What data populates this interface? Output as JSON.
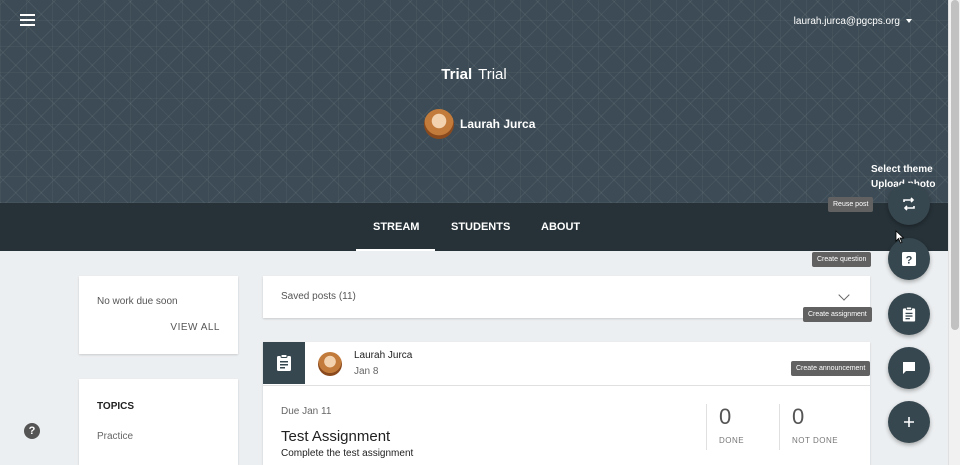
{
  "header": {
    "user_email": "laurah.jurca@pgcps.org",
    "class_name_bold": "Trial",
    "class_name_section": "Trial",
    "teacher_name": "Laurah Jurca",
    "select_theme": "Select theme",
    "upload_photo": "Upload photo"
  },
  "tabs": [
    {
      "label": "STREAM",
      "active": true
    },
    {
      "label": "STUDENTS",
      "active": false
    },
    {
      "label": "ABOUT",
      "active": false
    }
  ],
  "upcoming": {
    "text": "No work due soon",
    "view_all": "VIEW ALL"
  },
  "topics": {
    "heading": "TOPICS",
    "items": [
      "Practice"
    ]
  },
  "saved_posts": {
    "label": "Saved posts (11)"
  },
  "post": {
    "author": "Laurah Jurca",
    "date": "Jan 8",
    "due": "Due Jan 11",
    "title": "Test Assignment",
    "description": "Complete the test assignment",
    "done_count": "0",
    "done_label": "DONE",
    "not_done_count": "0",
    "not_done_label": "NOT DONE"
  },
  "fab_menu": {
    "reuse_post": "Reuse post",
    "create_question": "Create question",
    "create_assignment": "Create assignment",
    "create_announcement": "Create announcement"
  },
  "colors": {
    "banner": "#3c4b55",
    "tabs_bar": "#263238",
    "fab": "#37474f",
    "background": "#eceff1"
  }
}
